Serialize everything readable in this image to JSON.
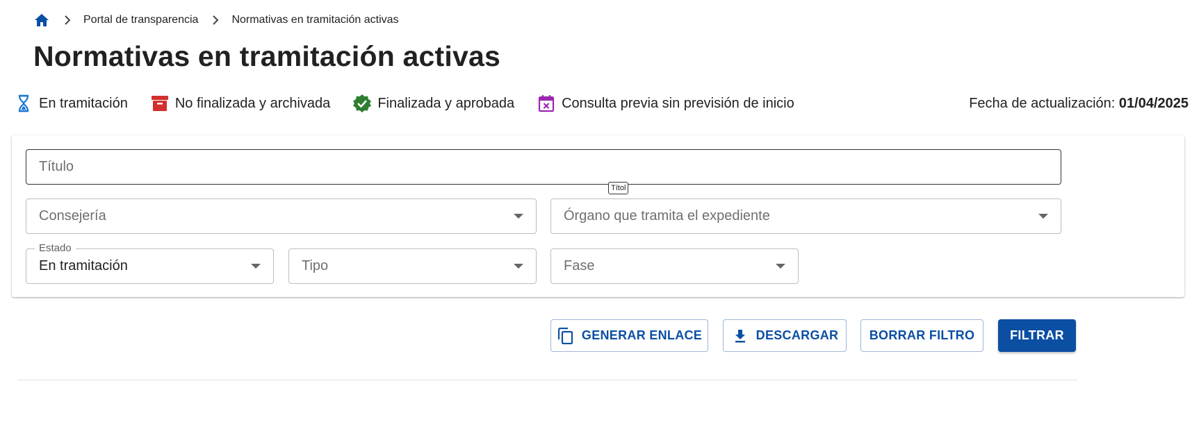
{
  "colors": {
    "primary": "#0b4fa3",
    "in_progress": "#1976d2",
    "archived": "#d32f2f",
    "approved": "#2e7d32",
    "consulta": "#9c27b0"
  },
  "breadcrumb": {
    "home_icon": "home-icon",
    "items": [
      "Portal de transparencia",
      "Normativas en tramitación activas"
    ]
  },
  "page": {
    "title": "Normativas en tramitación activas"
  },
  "legend": {
    "items": [
      {
        "icon": "hourglass-icon",
        "label": "En tramitación"
      },
      {
        "icon": "archive-box-icon",
        "label": "No finalizada y archivada"
      },
      {
        "icon": "check-badge-icon",
        "label": "Finalizada y aprobada"
      },
      {
        "icon": "calendar-x-icon",
        "label": "Consulta previa sin previsión de inicio"
      }
    ],
    "update_label": "Fecha de actualización: ",
    "update_date": "01/04/2025"
  },
  "filters": {
    "titulo": {
      "placeholder": "Título",
      "tooltip": "Títol"
    },
    "consejeria": {
      "placeholder": "Consejería"
    },
    "organo": {
      "placeholder": "Órgano que tramita el expediente"
    },
    "estado": {
      "label": "Estado",
      "value": "En tramitación"
    },
    "tipo": {
      "placeholder": "Tipo"
    },
    "fase": {
      "placeholder": "Fase"
    }
  },
  "actions": {
    "generar_enlace": "GENERAR ENLACE",
    "descargar": "DESCARGAR",
    "borrar_filtro": "BORRAR FILTRO",
    "filtrar": "FILTRAR"
  }
}
